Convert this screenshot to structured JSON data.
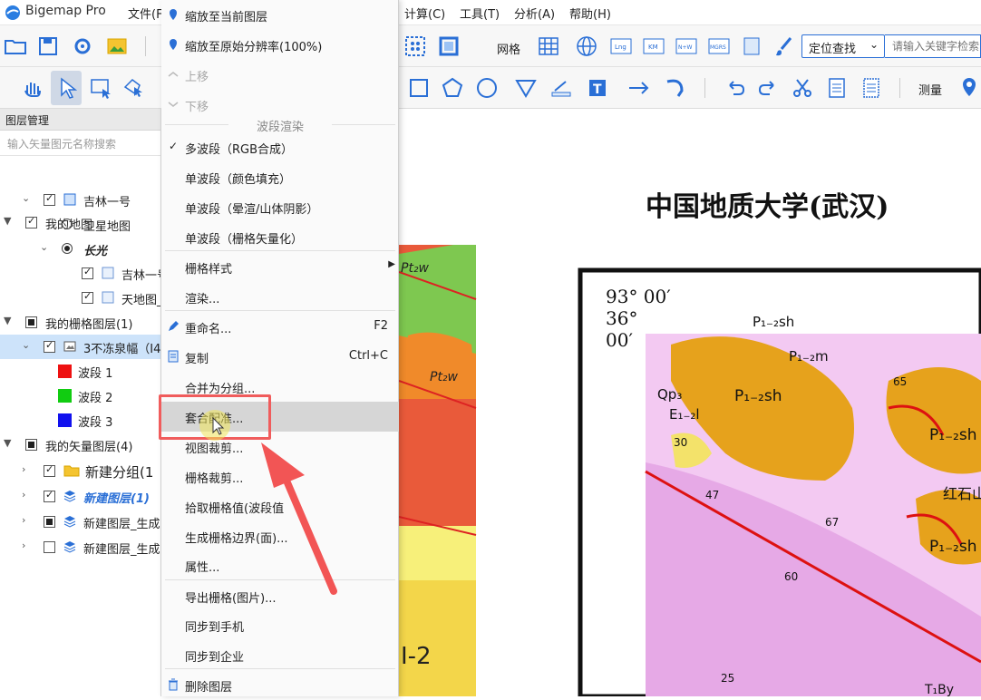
{
  "app": {
    "title": "Bigemap Pro"
  },
  "menubar": {
    "file": "文件(F",
    "calc": "计算(C)",
    "tools": "工具(T)",
    "analysis": "分析(A)",
    "help": "帮助(H)"
  },
  "toolbar": {
    "grid_label": "网格",
    "measure_label": "测量",
    "locate_label": "定位查找",
    "search_placeholder": "请输入关键字检索"
  },
  "sidebar": {
    "header": "图层管理",
    "search_placeholder": "输入矢量图元名称搜索",
    "tree": {
      "my_map": "我的地图",
      "jilin1": "吉林一号",
      "satellite": "卫星地图",
      "changguang": "长光",
      "jilin_sub": "吉林一号",
      "tianditu": "天地图_",
      "raster_group": "我的栅格图层(1)",
      "raster_layer": "3不冻泉幅（I4",
      "bands": [
        {
          "label": "波段 1",
          "color": "#ee1111"
        },
        {
          "label": "波段 2",
          "color": "#11cc11"
        },
        {
          "label": "波段 3",
          "color": "#1111ee"
        }
      ],
      "vector_group": "我的矢量图层(4)",
      "new_group": "新建分组(1",
      "new_layer": "新建图层(1)",
      "gen_layer_1": "新建图层_生成",
      "gen_layer_2": "新建图层_生成"
    }
  },
  "context_menu": {
    "zoom_current": "缩放至当前图层",
    "zoom_original": "缩放至原始分辨率(100%)",
    "move_up": "上移",
    "move_down": "下移",
    "band_section": "波段渲染",
    "multi_band": "多波段（RGB合成）",
    "single_fill": "单波段（颜色填充）",
    "single_hillshade": "单波段（晕渲/山体阴影）",
    "single_vector": "单波段（栅格矢量化）",
    "raster_style": "栅格样式",
    "render": "渲染...",
    "rename": "重命名...",
    "rename_shortcut": "F2",
    "copy": "复制",
    "copy_shortcut": "Ctrl+C",
    "merge_group": "合并为分组...",
    "georef": "套合配准...",
    "view_clip": "视图裁剪...",
    "raster_clip": "栅格裁剪...",
    "pick_value": "拾取栅格值(波段值",
    "gen_boundary": "生成栅格边界(面)...",
    "properties": "属性...",
    "export_raster": "导出栅格(图片)...",
    "sync_phone": "同步到手机",
    "sync_company": "同步到企业",
    "delete_layer": "删除图层"
  },
  "map": {
    "title": "中国地质大学(武汉)",
    "lon": "93° 00′",
    "lat_deg": "36°",
    "lat_min": "00′",
    "labels": [
      "P₁₋₂sh",
      "P₁₋₂sh",
      "P₁₋₂m",
      "P₁₋₂sh",
      "P₁₋₂sh",
      "Qp₃",
      "E₁₋₂l",
      "Pt₂w",
      "Pt₂w",
      "T₁By",
      "红石山",
      "I-2"
    ],
    "numbers": [
      "30",
      "47",
      "67",
      "60",
      "65",
      "25"
    ]
  }
}
